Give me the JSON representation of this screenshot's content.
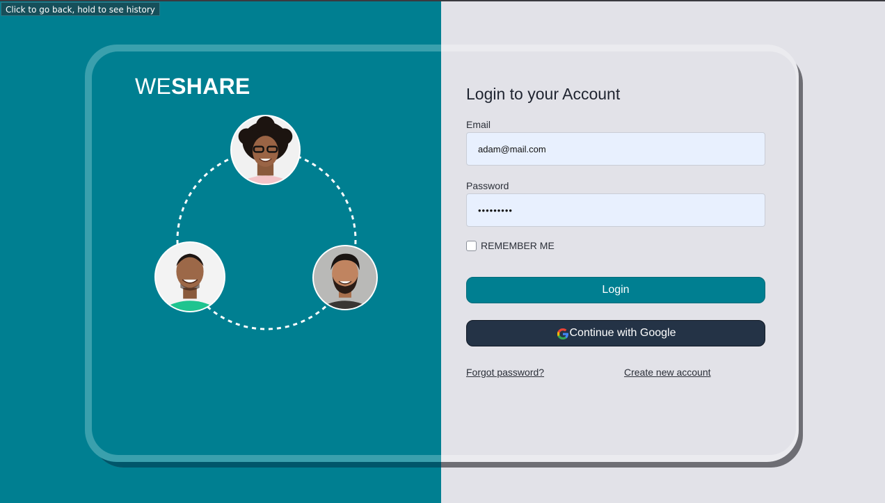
{
  "browser": {
    "back_tooltip": "Click to go back, hold to see history"
  },
  "brand": {
    "logo_part1": "WE",
    "logo_part2": "SHARE",
    "primary_color": "#007f91",
    "dark_button_color": "#243346"
  },
  "login_form": {
    "title": "Login to your Account",
    "email_label": "Email",
    "email_value": "adam@mail.com",
    "password_label": "Password",
    "password_value": "password1",
    "remember_label": "REMEMBER ME",
    "remember_checked": false,
    "login_button": "Login",
    "google_button": "Continue with Google",
    "forgot_link": "Forgot password?",
    "create_link": "Create new account"
  },
  "illustration": {
    "avatars": [
      "woman-avatar",
      "man-green-shirt-avatar",
      "bearded-man-avatar"
    ]
  }
}
